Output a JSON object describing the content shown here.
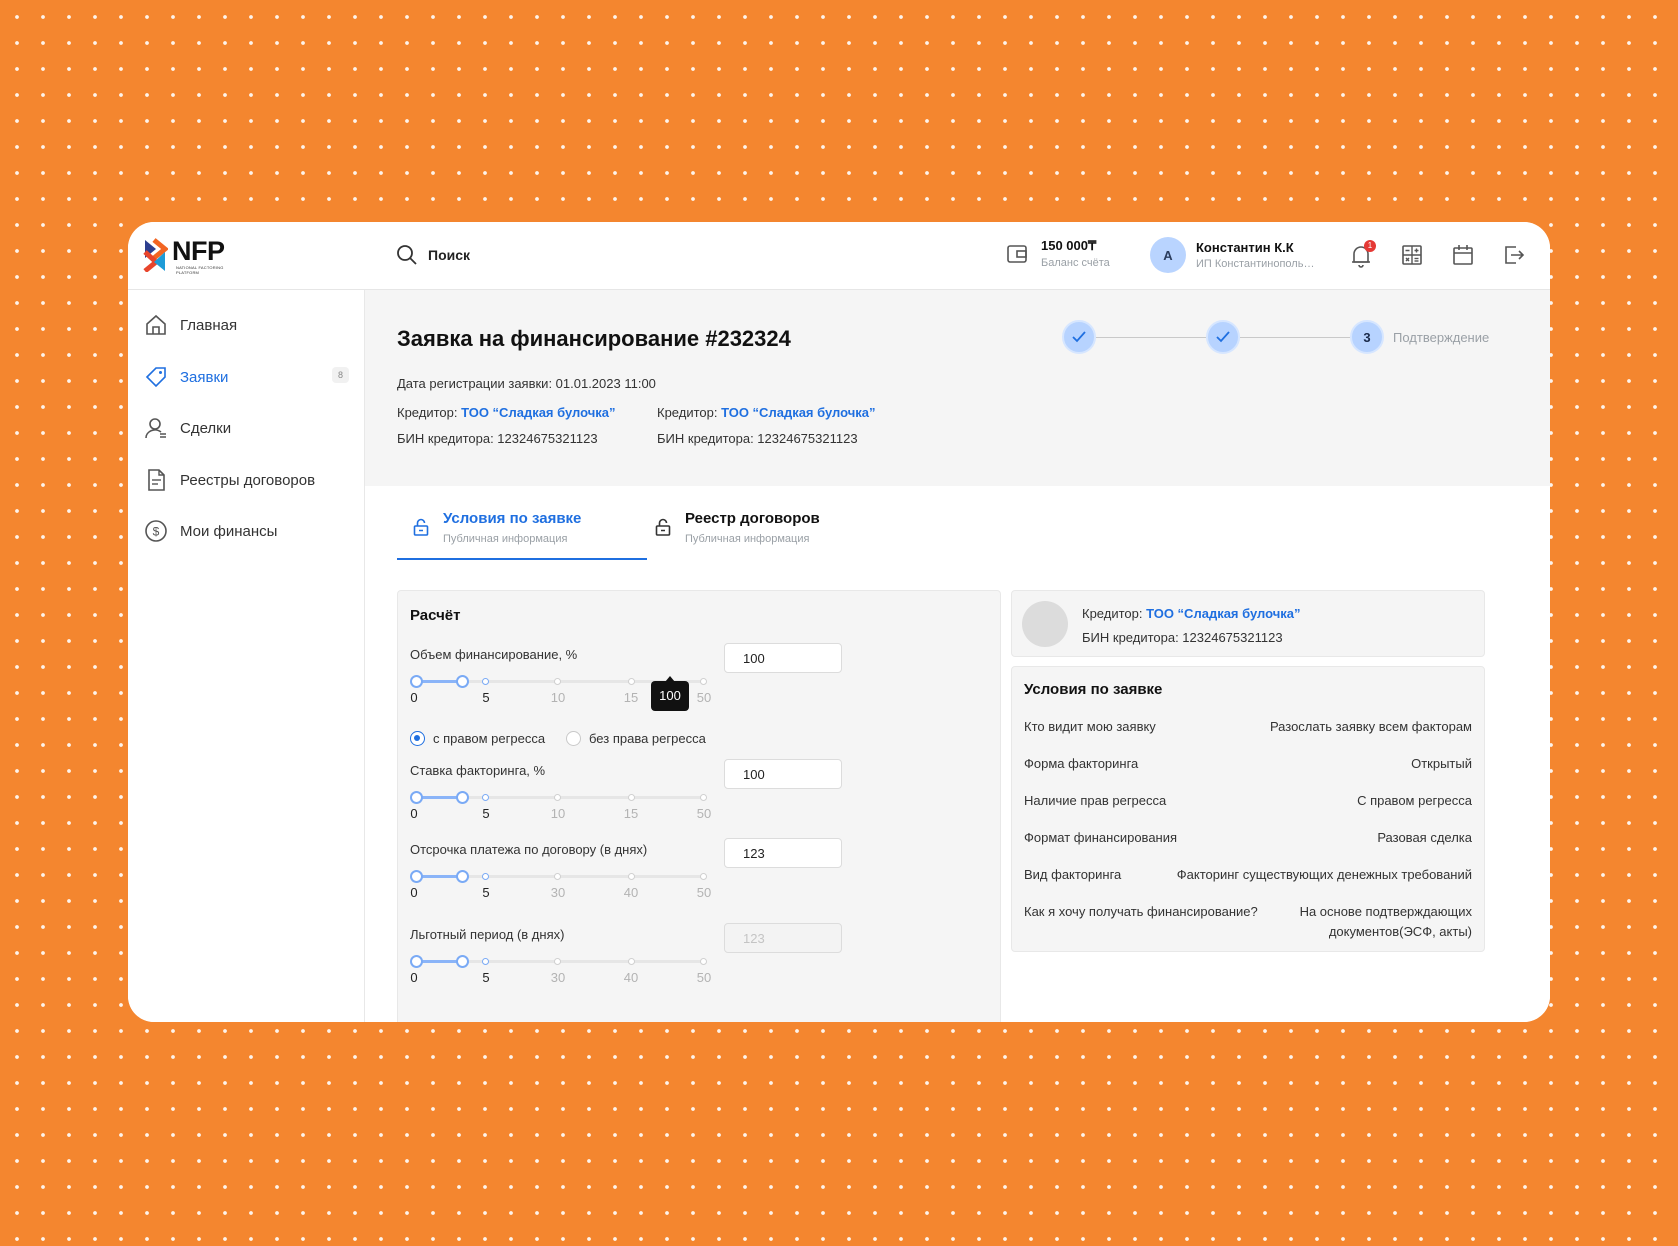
{
  "app": {
    "logo": "NFP",
    "logo_sub": "NATIONAL FACTORING PLATFORM"
  },
  "search": {
    "label": "Поиск"
  },
  "balance": {
    "value": "150 000₸",
    "label": "Баланс счёта"
  },
  "user": {
    "initial": "А",
    "name": "Константин К.К",
    "company": "ИП Константинопольский"
  },
  "notifications": {
    "count": "1"
  },
  "sidebar": {
    "items": [
      {
        "label": "Главная",
        "icon": "home-icon"
      },
      {
        "label": "Заявки",
        "icon": "tag-icon",
        "badge": "8"
      },
      {
        "label": "Сделки",
        "icon": "user-icon"
      },
      {
        "label": "Реестры договоров",
        "icon": "document-icon"
      },
      {
        "label": "Мои финансы",
        "icon": "coin-icon"
      }
    ]
  },
  "header": {
    "title": "Заявка на финансирование #232324",
    "date": "Дата регистрации заявки: 01.01.2023 11:00",
    "creditors": [
      {
        "label": "Кредитор:",
        "name": "ТОО “Сладкая булочка”",
        "bin": "БИН кредитора: 12324675321123"
      },
      {
        "label": "Кредитор:",
        "name": "ТОО “Сладкая булочка”",
        "bin": "БИН кредитора: 12324675321123"
      }
    ]
  },
  "stepper": {
    "step3_number": "3",
    "step3_label": "Подтверждение"
  },
  "tabs": [
    {
      "title": "Условия по заявке",
      "subtitle": "Публичная информация",
      "active": true
    },
    {
      "title": "Реестр договоров",
      "subtitle": "Публичная информация",
      "active": false
    }
  ],
  "calc": {
    "title": "Расчёт",
    "fields": [
      {
        "label": "Объем финансирование, %",
        "value": "100",
        "ticks": [
          "0",
          "5",
          "10",
          "15",
          "50"
        ]
      },
      {
        "label": "Ставка факторинга, %",
        "value": "100",
        "ticks": [
          "0",
          "5",
          "10",
          "15",
          "50"
        ]
      },
      {
        "label": "Отсрочка платежа по договору (в днях)",
        "value": "123",
        "ticks": [
          "0",
          "5",
          "30",
          "40",
          "50"
        ]
      },
      {
        "label": "Льготный период (в днях)",
        "value": "123",
        "ticks": [
          "0",
          "5",
          "30",
          "40",
          "50"
        ]
      }
    ],
    "tooltip": "100",
    "radio": [
      "с правом регресса",
      "без права регресса"
    ]
  },
  "creditor_card": {
    "label": "Кредитор:",
    "name": "ТОО “Сладкая булочка”",
    "bin": "БИН кредитора: 12324675321123"
  },
  "conditions": {
    "title": "Условия по заявке",
    "rows": [
      {
        "k": "Кто видит мою заявку",
        "v": "Разослать заявку всем факторам"
      },
      {
        "k": "Форма факторинга",
        "v": "Открытый"
      },
      {
        "k": "Наличие прав регресса",
        "v": "С правом регресса"
      },
      {
        "k": "Формат финансирования",
        "v": "Разовая сделка"
      },
      {
        "k": "Вид факторинга",
        "v": "Факторинг существующих денежных требований"
      },
      {
        "k": "Как я хочу получать финансирование?",
        "v": "На основе подтверждающих документов(ЭСФ, акты)"
      }
    ]
  },
  "colors": {
    "accent": "#1f6fe0",
    "background": "#F4862F",
    "step": "#b7d3ff"
  }
}
